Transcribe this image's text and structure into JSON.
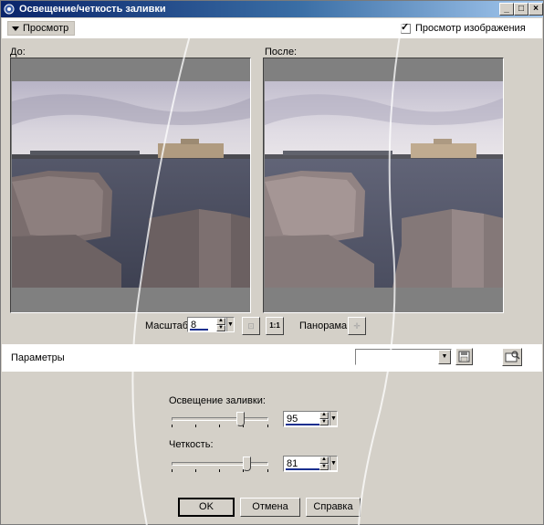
{
  "window": {
    "title": "Освещение/четкость заливки"
  },
  "toolbar": {
    "preview_label": "Просмотр",
    "preview_image_label": "Просмотр изображения",
    "preview_image_checked": true
  },
  "panes": {
    "before_label": "До:",
    "after_label": "После:"
  },
  "zoom": {
    "label": "Масштаб:",
    "value": "8",
    "one_to_one": "1:1",
    "pan_label": "Панорама:"
  },
  "params": {
    "label": "Параметры",
    "preset_value": ""
  },
  "controls": {
    "fill_light_label": "Освещение заливки:",
    "fill_light_value": "95",
    "sharpness_label": "Четкость:",
    "sharpness_value": "81"
  },
  "buttons": {
    "ok": "OK",
    "cancel": "Отмена",
    "help": "Справка"
  },
  "icons": {
    "title_icon": "app-icon",
    "save": "save-icon",
    "load": "load-preset-icon",
    "fit": "fit-icon",
    "pan": "pan-icon"
  }
}
